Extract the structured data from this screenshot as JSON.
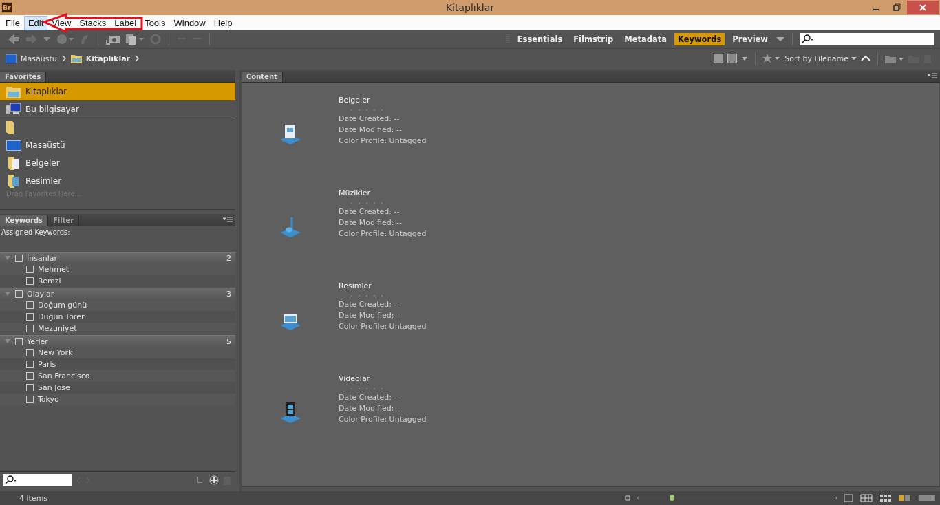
{
  "window": {
    "title": "Kitaplıklar",
    "app_badge": "Br"
  },
  "menu": [
    {
      "label": "File",
      "selected": false
    },
    {
      "label": "Edit",
      "selected": true
    },
    {
      "label": "View",
      "selected": false
    },
    {
      "label": "Stacks",
      "selected": false
    },
    {
      "label": "Label",
      "selected": false
    },
    {
      "label": "Tools",
      "selected": false
    },
    {
      "label": "Window",
      "selected": false
    },
    {
      "label": "Help",
      "selected": false
    }
  ],
  "workspaces": [
    {
      "label": "Essentials",
      "selected": false
    },
    {
      "label": "Filmstrip",
      "selected": false
    },
    {
      "label": "Metadata",
      "selected": false
    },
    {
      "label": "Keywords",
      "selected": true
    },
    {
      "label": "Preview",
      "selected": false
    }
  ],
  "breadcrumb": [
    {
      "label": "Masaüstü",
      "kind": "desktop",
      "current": false
    },
    {
      "label": "Kitaplıklar",
      "kind": "library",
      "current": true
    }
  ],
  "sort": {
    "label": "Sort by Filename"
  },
  "favorites": {
    "tab": "Favorites",
    "hint": "Drag Favorites Here...",
    "items": [
      {
        "label": "Kitaplıklar",
        "kind": "library",
        "selected": true
      },
      {
        "label": "Bu bilgisayar",
        "kind": "computer",
        "selected": false
      },
      {
        "kind": "folder",
        "selected": false
      },
      {
        "label": "Masaüstü",
        "kind": "desktop",
        "selected": false
      },
      {
        "label": "Belgeler",
        "kind": "documents",
        "selected": false
      },
      {
        "label": "Resimler",
        "kind": "pictures",
        "selected": false
      }
    ]
  },
  "keywords_panel": {
    "tabs": [
      {
        "label": "Keywords",
        "selected": true
      },
      {
        "label": "Filter",
        "selected": false
      }
    ],
    "assigned_label": "Assigned Keywords:",
    "groups": [
      {
        "label": "İnsanlar",
        "count": "2",
        "expanded": true,
        "checked": false,
        "children": [
          {
            "label": "Mehmet",
            "checked": false
          },
          {
            "label": "Remzi",
            "checked": false
          }
        ]
      },
      {
        "label": "Olaylar",
        "count": "3",
        "expanded": true,
        "checked": false,
        "children": [
          {
            "label": "Doğum günü",
            "checked": false
          },
          {
            "label": "Düğün Töreni",
            "checked": false
          },
          {
            "label": "Mezuniyet",
            "checked": false
          }
        ]
      },
      {
        "label": "Yerler",
        "count": "5",
        "expanded": true,
        "checked": false,
        "children": [
          {
            "label": "New York",
            "checked": false
          },
          {
            "label": "Paris",
            "checked": false
          },
          {
            "label": "San Francisco",
            "checked": false
          },
          {
            "label": "San Jose",
            "checked": false
          },
          {
            "label": "Tokyo",
            "checked": false
          }
        ]
      }
    ]
  },
  "content": {
    "tab": "Content",
    "items": [
      {
        "name": "Belgeler",
        "kind": "documents",
        "lines": [
          "Date Created: --",
          "Date Modified: --",
          "Color Profile: Untagged"
        ]
      },
      {
        "name": "Müzikler",
        "kind": "music",
        "lines": [
          "Date Created: --",
          "Date Modified: --",
          "Color Profile: Untagged"
        ]
      },
      {
        "name": "Resimler",
        "kind": "pictures",
        "lines": [
          "Date Created: --",
          "Date Modified: --",
          "Color Profile: Untagged"
        ]
      },
      {
        "name": "Videolar",
        "kind": "videos",
        "lines": [
          "Date Created: --",
          "Date Modified: --",
          "Color Profile: Untagged"
        ]
      }
    ]
  },
  "status_bar": {
    "count": "4 items",
    "thumbnail_size": {
      "level": 0.17
    }
  },
  "annotation": {
    "kind": "arrow"
  }
}
